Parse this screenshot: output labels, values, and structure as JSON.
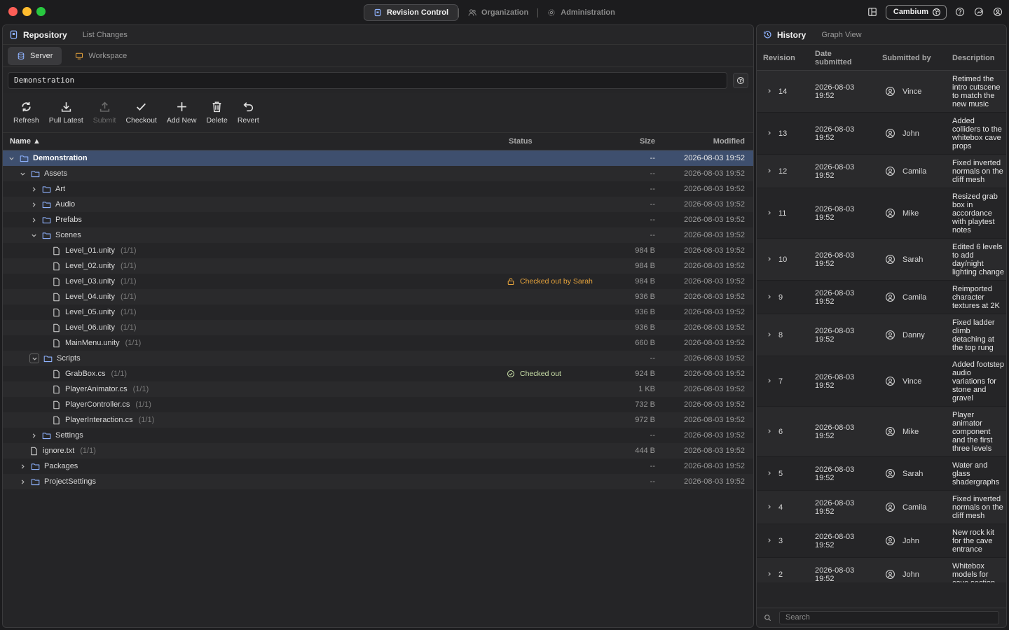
{
  "topnav": {
    "items": [
      {
        "label": "Revision Control",
        "active": true,
        "icon": "repo-icon"
      },
      {
        "label": "Organization",
        "active": false,
        "icon": "people-icon"
      },
      {
        "label": "Administration",
        "active": false,
        "icon": "gear-icon"
      }
    ],
    "org_name": "Cambium"
  },
  "repository": {
    "title": "Repository",
    "subtitle": "List Changes",
    "tabs": [
      {
        "label": "Server",
        "active": true
      },
      {
        "label": "Workspace",
        "active": false
      }
    ],
    "path": "Demonstration",
    "toolbar": [
      {
        "label": "Refresh",
        "icon": "refresh-icon",
        "enabled": true
      },
      {
        "label": "Pull Latest",
        "icon": "download-icon",
        "enabled": true
      },
      {
        "label": "Submit",
        "icon": "upload-icon",
        "enabled": false
      },
      {
        "label": "Checkout",
        "icon": "check-icon",
        "enabled": true
      },
      {
        "label": "Add New",
        "icon": "plus-icon",
        "enabled": true
      },
      {
        "label": "Delete",
        "icon": "trash-icon",
        "enabled": true
      },
      {
        "label": "Revert",
        "icon": "undo-icon",
        "enabled": true
      }
    ],
    "columns": {
      "name": "Name ▲",
      "status": "Status",
      "size": "Size",
      "modified": "Modified"
    },
    "rows": [
      {
        "name": "Demonstration",
        "type": "folder",
        "depth": 0,
        "chevron": "down",
        "size": "--",
        "modified": "2026-08-03 19:52",
        "selected": true
      },
      {
        "name": "Assets",
        "type": "folder",
        "depth": 1,
        "chevron": "down",
        "size": "--",
        "modified": "2026-08-03 19:52"
      },
      {
        "name": "Art",
        "type": "folder",
        "depth": 2,
        "chevron": "right",
        "size": "--",
        "modified": "2026-08-03 19:52"
      },
      {
        "name": "Audio",
        "type": "folder",
        "depth": 2,
        "chevron": "right",
        "size": "--",
        "modified": "2026-08-03 19:52"
      },
      {
        "name": "Prefabs",
        "type": "folder",
        "depth": 2,
        "chevron": "right",
        "size": "--",
        "modified": "2026-08-03 19:52"
      },
      {
        "name": "Scenes",
        "type": "folder",
        "depth": 2,
        "chevron": "down",
        "size": "--",
        "modified": "2026-08-03 19:52"
      },
      {
        "name": "Level_01.unity",
        "count": "(1/1)",
        "type": "file",
        "depth": 3,
        "size": "984 B",
        "modified": "2026-08-03 19:52"
      },
      {
        "name": "Level_02.unity",
        "count": "(1/1)",
        "type": "file",
        "depth": 3,
        "size": "984 B",
        "modified": "2026-08-03 19:52"
      },
      {
        "name": "Level_03.unity",
        "count": "(1/1)",
        "type": "file",
        "depth": 3,
        "size": "984 B",
        "modified": "2026-08-03 19:52",
        "status": "Checked out by Sarah",
        "status_kind": "warn"
      },
      {
        "name": "Level_04.unity",
        "count": "(1/1)",
        "type": "file",
        "depth": 3,
        "size": "936 B",
        "modified": "2026-08-03 19:52"
      },
      {
        "name": "Level_05.unity",
        "count": "(1/1)",
        "type": "file",
        "depth": 3,
        "size": "936 B",
        "modified": "2026-08-03 19:52"
      },
      {
        "name": "Level_06.unity",
        "count": "(1/1)",
        "type": "file",
        "depth": 3,
        "size": "936 B",
        "modified": "2026-08-03 19:52"
      },
      {
        "name": "MainMenu.unity",
        "count": "(1/1)",
        "type": "file",
        "depth": 3,
        "size": "660 B",
        "modified": "2026-08-03 19:52"
      },
      {
        "name": "Scripts",
        "type": "folder",
        "depth": 2,
        "chevron": "down-boxed",
        "size": "--",
        "modified": "2026-08-03 19:52"
      },
      {
        "name": "GrabBox.cs",
        "count": "(1/1)",
        "type": "file",
        "depth": 3,
        "size": "924 B",
        "modified": "2026-08-03 19:52",
        "status": "Checked out",
        "status_kind": "ok"
      },
      {
        "name": "PlayerAnimator.cs",
        "count": "(1/1)",
        "type": "file",
        "depth": 3,
        "size": "1 KB",
        "modified": "2026-08-03 19:52"
      },
      {
        "name": "PlayerController.cs",
        "count": "(1/1)",
        "type": "file",
        "depth": 3,
        "size": "732 B",
        "modified": "2026-08-03 19:52"
      },
      {
        "name": "PlayerInteraction.cs",
        "count": "(1/1)",
        "type": "file",
        "depth": 3,
        "size": "972 B",
        "modified": "2026-08-03 19:52"
      },
      {
        "name": "Settings",
        "type": "folder",
        "depth": 2,
        "chevron": "right",
        "size": "--",
        "modified": "2026-08-03 19:52"
      },
      {
        "name": "ignore.txt",
        "count": "(1/1)",
        "type": "file",
        "depth": 1,
        "size": "444 B",
        "modified": "2026-08-03 19:52"
      },
      {
        "name": "Packages",
        "type": "folder",
        "depth": 1,
        "chevron": "right",
        "size": "--",
        "modified": "2026-08-03 19:52"
      },
      {
        "name": "ProjectSettings",
        "type": "folder",
        "depth": 1,
        "chevron": "right",
        "size": "--",
        "modified": "2026-08-03 19:52"
      }
    ]
  },
  "history": {
    "title": "History",
    "subtitle": "Graph View",
    "columns": {
      "revision": "Revision",
      "date": "Date submitted",
      "user": "Submitted by",
      "description": "Description"
    },
    "rows": [
      {
        "rev": "14",
        "date": "2026-08-03 19:52",
        "user": "Vince",
        "description": "Retimed the intro cutscene to match the new music"
      },
      {
        "rev": "13",
        "date": "2026-08-03 19:52",
        "user": "John",
        "description": "Added colliders to the whitebox cave props"
      },
      {
        "rev": "12",
        "date": "2026-08-03 19:52",
        "user": "Camila",
        "description": "Fixed inverted normals on the cliff mesh"
      },
      {
        "rev": "11",
        "date": "2026-08-03 19:52",
        "user": "Mike",
        "description": "Resized grab box in accordance with playtest notes"
      },
      {
        "rev": "10",
        "date": "2026-08-03 19:52",
        "user": "Sarah",
        "description": "Edited 6 levels to add day/night lighting change"
      },
      {
        "rev": "9",
        "date": "2026-08-03 19:52",
        "user": "Camila",
        "description": "Reimported character textures at 2K"
      },
      {
        "rev": "8",
        "date": "2026-08-03 19:52",
        "user": "Danny",
        "description": "Fixed ladder climb detaching at the top rung"
      },
      {
        "rev": "7",
        "date": "2026-08-03 19:52",
        "user": "Vince",
        "description": "Added footstep audio variations for stone and gravel"
      },
      {
        "rev": "6",
        "date": "2026-08-03 19:52",
        "user": "Mike",
        "description": "Player animator component and the first three levels"
      },
      {
        "rev": "5",
        "date": "2026-08-03 19:52",
        "user": "Sarah",
        "description": "Water and glass shadergraphs"
      },
      {
        "rev": "4",
        "date": "2026-08-03 19:52",
        "user": "Camila",
        "description": "Fixed inverted normals on the cliff mesh"
      },
      {
        "rev": "3",
        "date": "2026-08-03 19:52",
        "user": "John",
        "description": "New rock kit for the cave entrance"
      },
      {
        "rev": "2",
        "date": "2026-08-03 19:52",
        "user": "John",
        "description": "Whitebox models for cave section"
      }
    ],
    "search_placeholder": "Search"
  }
}
